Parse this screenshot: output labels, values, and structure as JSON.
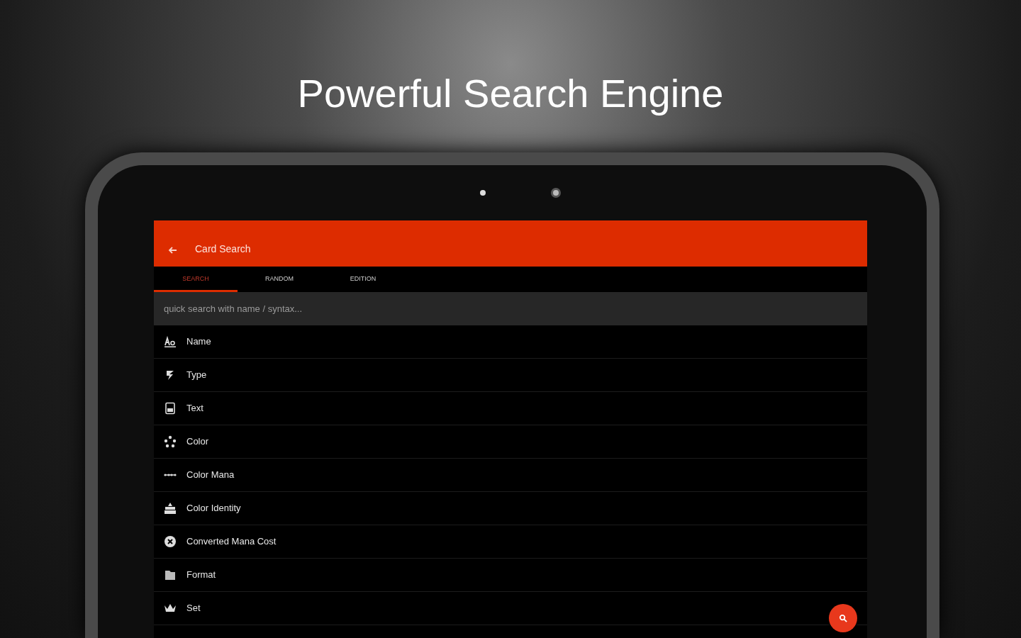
{
  "headline": "Powerful Search Engine",
  "app_bar": {
    "title": "Card Search"
  },
  "tabs": [
    {
      "label": "SEARCH",
      "selected": true
    },
    {
      "label": "RANDOM",
      "selected": false
    },
    {
      "label": "EDITION",
      "selected": false
    }
  ],
  "search": {
    "placeholder": "quick search with name / syntax..."
  },
  "fields": [
    {
      "label": "Name",
      "kind": "name"
    },
    {
      "label": "Type",
      "kind": "type"
    },
    {
      "label": "Text",
      "kind": "text"
    },
    {
      "label": "Color",
      "kind": "color"
    },
    {
      "label": "Color Mana",
      "kind": "mana"
    },
    {
      "label": "Color Identity",
      "kind": "identity"
    },
    {
      "label": "Converted Mana Cost",
      "kind": "cost"
    },
    {
      "label": "Format",
      "kind": "format"
    },
    {
      "label": "Set",
      "kind": "set"
    }
  ]
}
